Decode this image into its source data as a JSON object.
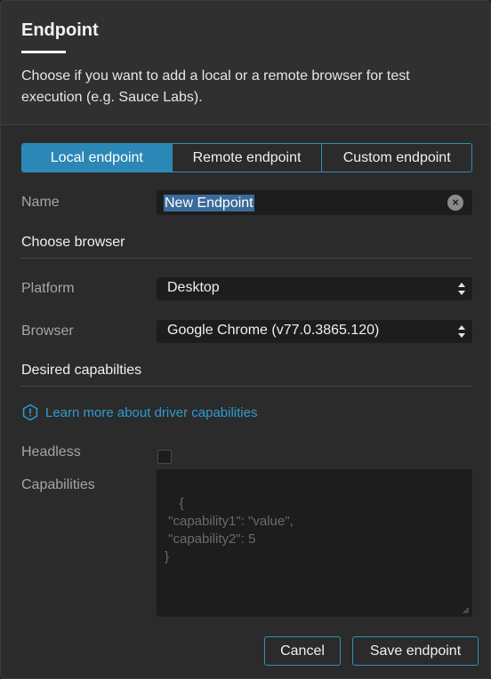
{
  "dialog": {
    "title": "Endpoint",
    "description": "Choose if you want to add a local or a remote browser for test execution (e.g. Sauce Labs)."
  },
  "tabs": [
    {
      "label": "Local endpoint",
      "active": true
    },
    {
      "label": "Remote endpoint",
      "active": false
    },
    {
      "label": "Custom endpoint",
      "active": false
    }
  ],
  "name_field": {
    "label": "Name",
    "value": "New Endpoint"
  },
  "choose_browser": {
    "heading": "Choose browser",
    "platform": {
      "label": "Platform",
      "value": "Desktop"
    },
    "browser": {
      "label": "Browser",
      "value": "Google Chrome (v77.0.3865.120)"
    }
  },
  "capabilities": {
    "heading": "Desired capabilties",
    "learn_more": "Learn more about driver capabilities",
    "headless_label": "Headless",
    "headless_checked": false,
    "capabilities_label": "Capabilities",
    "placeholder": "{\n \"capability1\": \"value\",\n \"capability2\": 5\n}"
  },
  "footer": {
    "cancel": "Cancel",
    "save": "Save endpoint"
  },
  "colors": {
    "accent": "#2b87b5",
    "link": "#2f9bd0",
    "background": "#2b2b2b"
  }
}
